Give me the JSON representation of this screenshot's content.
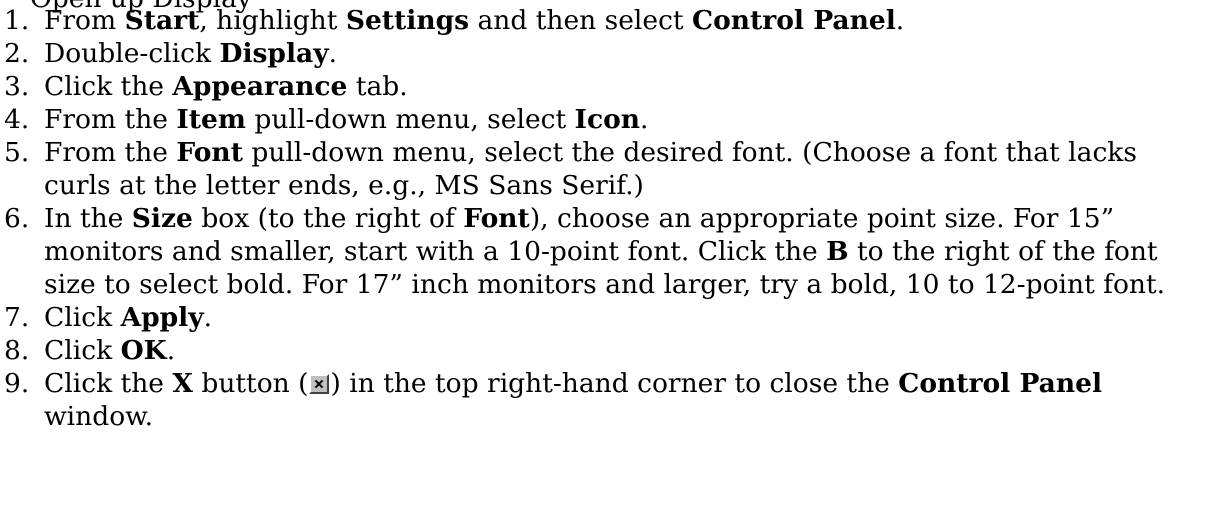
{
  "cutoff_line": "Open up Display",
  "steps": [
    {
      "num": "1.",
      "parts": [
        {
          "t": "From "
        },
        {
          "t": "Start",
          "b": true
        },
        {
          "t": ", highlight "
        },
        {
          "t": "Settings",
          "b": true
        },
        {
          "t": " and then select "
        },
        {
          "t": "Control Panel",
          "b": true
        },
        {
          "t": "."
        }
      ]
    },
    {
      "num": "2.",
      "parts": [
        {
          "t": "Double-click "
        },
        {
          "t": "Display",
          "b": true
        },
        {
          "t": "."
        }
      ]
    },
    {
      "num": "3.",
      "parts": [
        {
          "t": "Click the "
        },
        {
          "t": "Appearance",
          "b": true
        },
        {
          "t": " tab."
        }
      ]
    },
    {
      "num": "4.",
      "parts": [
        {
          "t": "From the "
        },
        {
          "t": "Item",
          "b": true
        },
        {
          "t": " pull-down menu, select "
        },
        {
          "t": "Icon",
          "b": true
        },
        {
          "t": "."
        }
      ]
    },
    {
      "num": "5.",
      "parts": [
        {
          "t": "From the "
        },
        {
          "t": "Font",
          "b": true
        },
        {
          "t": " pull-down menu, select the desired font. (Choose a font that lacks curls at the letter ends, e.g., MS Sans Serif.)"
        }
      ]
    },
    {
      "num": "6.",
      "parts": [
        {
          "t": "In the "
        },
        {
          "t": "Size",
          "b": true
        },
        {
          "t": " box (to the right of "
        },
        {
          "t": "Font",
          "b": true
        },
        {
          "t": "), choose an appropriate point size. For 15” monitors and smaller, start with a 10-point font. Click the "
        },
        {
          "t": "B",
          "b": true
        },
        {
          "t": " to the right of the font size to select bold. For 17” inch monitors and larger, try a bold, 10 to 12-point font."
        }
      ]
    },
    {
      "num": "7.",
      "parts": [
        {
          "t": "Click "
        },
        {
          "t": "Apply",
          "b": true
        },
        {
          "t": "."
        }
      ]
    },
    {
      "num": "8.",
      "parts": [
        {
          "t": "Click "
        },
        {
          "t": "OK",
          "b": true
        },
        {
          "t": "."
        }
      ]
    },
    {
      "num": "9.",
      "parts": [
        {
          "t": "Click the "
        },
        {
          "t": "X",
          "b": true
        },
        {
          "t": " button ("
        },
        {
          "icon": "close-x-button-icon"
        },
        {
          "t": ") in the top right-hand corner to close the "
        },
        {
          "t": "Control Panel",
          "b": true
        },
        {
          "t": " window."
        }
      ]
    }
  ]
}
